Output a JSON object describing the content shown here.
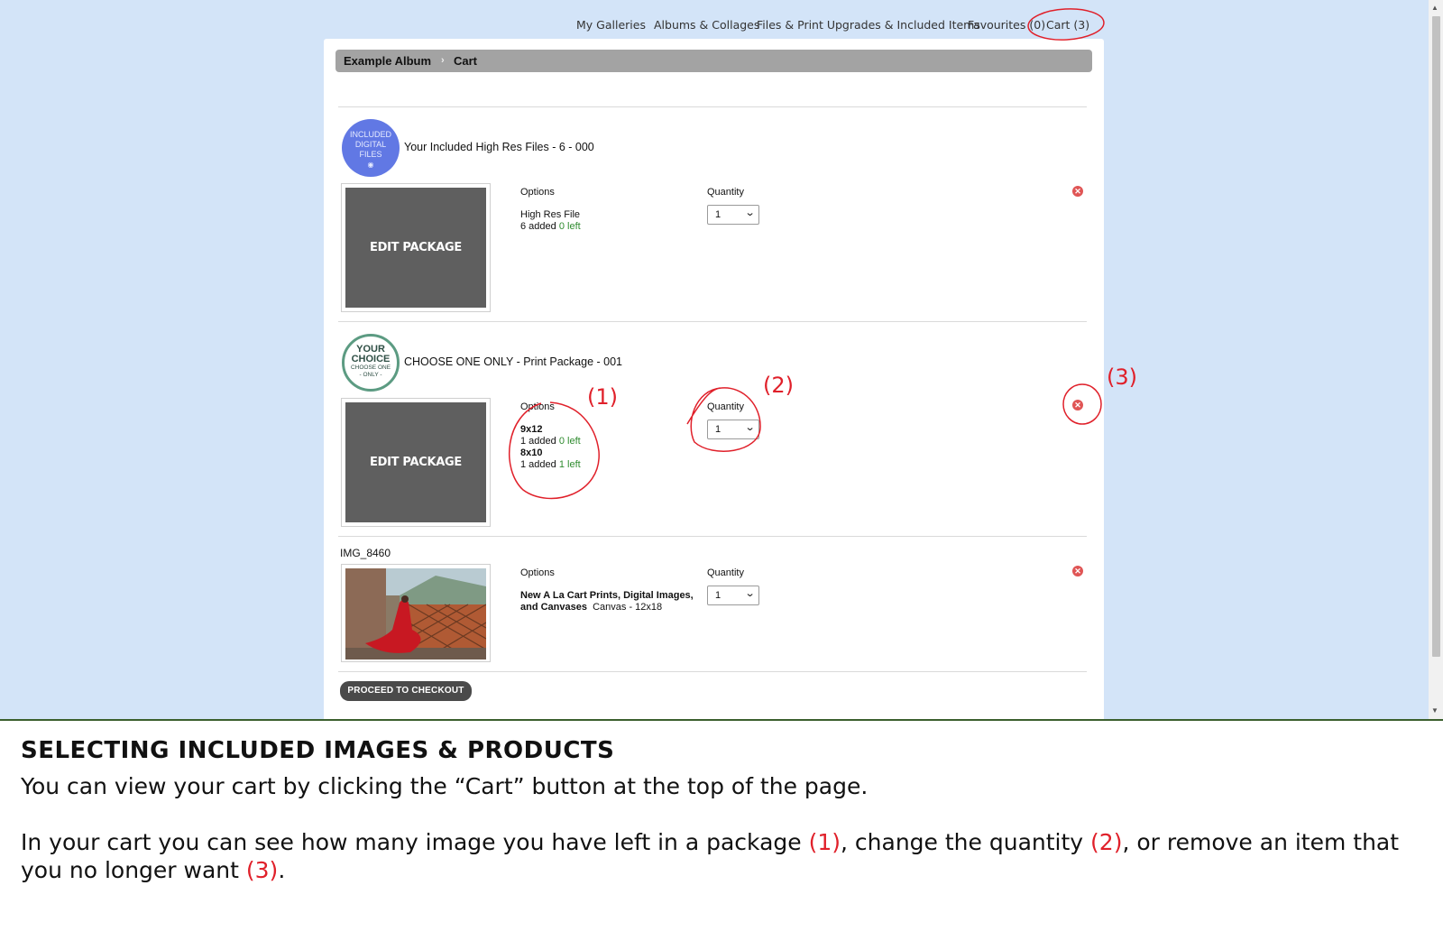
{
  "nav": {
    "my_galleries": "My Galleries",
    "albums": "Albums & Collages",
    "files": "Files & Print Upgrades & Included Items",
    "favourites": "Favourites (0)",
    "cart": "Cart (3)"
  },
  "breadcrumb": {
    "album": "Example Album",
    "separator": "›",
    "current": "Cart"
  },
  "items": [
    {
      "badge_lines": [
        "INCLUDED",
        "DIGITAL",
        "FILES"
      ],
      "title": "Your Included High Res Files - 6 - 000",
      "thumb_label": "EDIT PACKAGE",
      "options_label": "Options",
      "quantity_label": "Quantity",
      "option_name": "High Res File",
      "added_text": "6 added",
      "left_text": "0 left",
      "quantity": "1"
    },
    {
      "badge_big": [
        "YOUR",
        "CHOICE"
      ],
      "badge_small": [
        "CHOOSE ONE",
        "- ONLY -"
      ],
      "title": "CHOOSE ONE ONLY - Print Package - 001",
      "thumb_label": "EDIT PACKAGE",
      "options_label": "Options",
      "quantity_label": "Quantity",
      "options": [
        {
          "name": "9x12",
          "added": "1 added",
          "left": "0 left"
        },
        {
          "name": "8x10",
          "added": "1 added",
          "left": "1 left"
        }
      ],
      "quantity": "1"
    },
    {
      "title": "IMG_8460",
      "options_label": "Options",
      "quantity_label": "Quantity",
      "option_name_line1": "New A La Cart Prints, Digital Images,",
      "option_name_line2": "and Canvases",
      "option_detail": "Canvas - 12x18",
      "quantity": "1"
    }
  ],
  "checkout_label": "PROCEED TO CHECKOUT",
  "annotations": {
    "one": "(1)",
    "two": "(2)",
    "three": "(3)",
    "color": "#e0202a"
  },
  "instructions": {
    "title": "SELECTING INCLUDED IMAGES & PRODUCTS",
    "line1": "You can view your cart by clicking the “Cart” button at the top of the page.",
    "p_a": "In your cart you can see how many image you have left in a package ",
    "p_n1": "(1)",
    "p_b": ", change the quantity ",
    "p_n2": "(2)",
    "p_c": ", or remove an item that you no longer want ",
    "p_n3": "(3)",
    "p_d": "."
  },
  "icons": {
    "remove": "remove-circle-icon",
    "select": "chevron-down-icon"
  }
}
